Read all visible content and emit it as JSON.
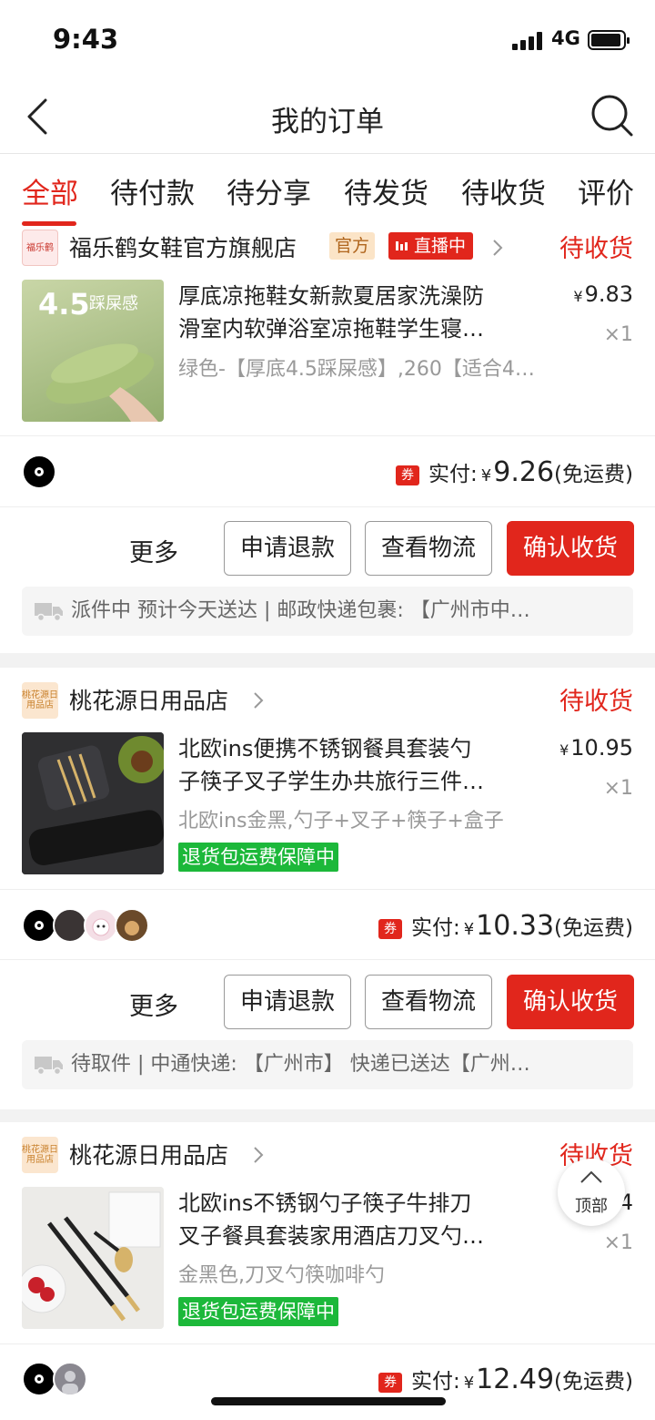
{
  "status_bar": {
    "time": "9:43",
    "network": "4G"
  },
  "nav": {
    "title": "我的订单"
  },
  "tabs": [
    "全部",
    "待付款",
    "待分享",
    "待发货",
    "待收货",
    "评价"
  ],
  "colors": {
    "accent": "#e1261c",
    "guarantee_green": "#1cb83a"
  },
  "orders": [
    {
      "shop": {
        "name": "福乐鹤女鞋官方旗舰店",
        "logo_text": "福乐鹤",
        "badge_official": "官方",
        "badge_live": "直播中"
      },
      "status": "待收货",
      "product": {
        "image_text": "4.5",
        "image_subtext": "踩屎感",
        "title_line1": "厚底凉拖鞋女新款夏居家洗澡防",
        "title_line2": "滑室内软弹浴室凉拖鞋学生寝…",
        "sku": "绿色-【厚底4.5踩屎感】,260【适合4…",
        "price": "9.83",
        "qty": "×1"
      },
      "payment": {
        "label": "实付:",
        "amount": "9.26",
        "note": "(免运费)",
        "coupon": "券"
      },
      "actions": {
        "more": "更多",
        "refund": "申请退款",
        "logistics": "查看物流",
        "confirm": "确认收货"
      },
      "logistics_text": "派件中 预计今天送达 | 邮政快递包裹: 【广州市中…"
    },
    {
      "shop": {
        "name": "桃花源日用品店",
        "logo_text": "桃花源日用品店"
      },
      "status": "待收货",
      "product": {
        "title_line1": "北欧ins便携不锈钢餐具套装勺",
        "title_line2": "子筷子叉子学生办共旅行三件…",
        "sku": "北欧ins金黑,勺子+叉子+筷子+盒子",
        "tag": "退货包运费保障中",
        "price": "10.95",
        "qty": "×1"
      },
      "payment": {
        "label": "实付:",
        "amount": "10.33",
        "note": "(免运费)",
        "coupon": "券"
      },
      "actions": {
        "more": "更多",
        "refund": "申请退款",
        "logistics": "查看物流",
        "confirm": "确认收货"
      },
      "logistics_text": "待取件 | 中通快递: 【广州市】 快递已送达【广州…"
    },
    {
      "shop": {
        "name": "桃花源日用品店",
        "logo_text": "桃花源日用品店"
      },
      "status": "待收货",
      "product": {
        "title_line1": "北欧ins不锈钢勺子筷子牛排刀",
        "title_line2": "叉子餐具套装家用酒店刀叉勺…",
        "sku": "金黑色,刀叉勺筷咖啡勺",
        "tag": "退货包运费保障中",
        "price": "4",
        "qty": "×1"
      },
      "payment": {
        "label": "实付:",
        "amount": "12.49",
        "note": "(免运费)",
        "coupon": "券"
      }
    }
  ],
  "top_button": "顶部"
}
